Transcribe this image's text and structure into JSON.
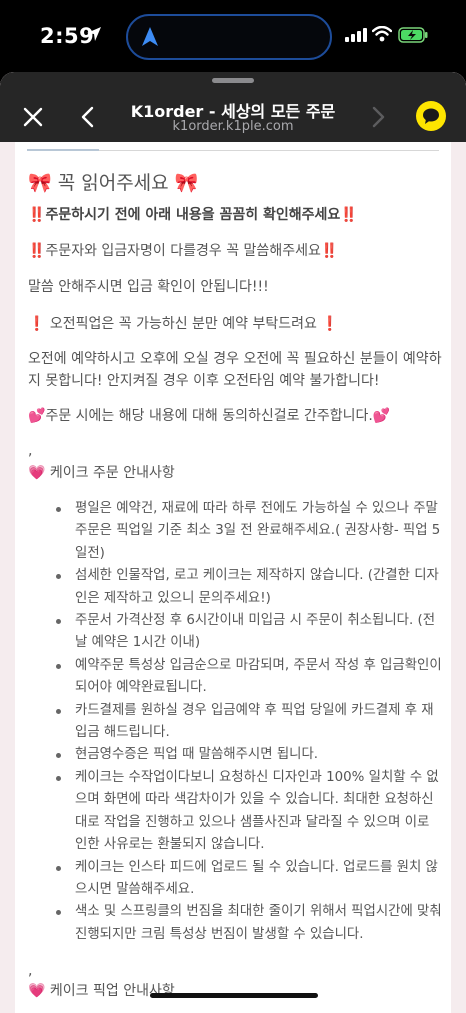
{
  "status_bar": {
    "time": "2:59"
  },
  "browser": {
    "title": "K1order - 세상의 모든 주문",
    "url": "k1order.k1ple.com"
  },
  "notice": {
    "heading_bow_left": "🎀",
    "heading": "꼭 읽어주세요",
    "heading_bow_right": "🎀",
    "line1_mark": "‼️",
    "line1": "주문하시기 전에 아래 내용을 꼼꼼히 확인해주세요",
    "line2_mark": "‼️",
    "line2": "주문자와 입금자명이 다를경우 꼭 말씀해주세요",
    "line3": "말씀 안해주시면 입금 확인이 안됩니다!!!",
    "line4_mark": "❗",
    "line4": "오전픽업은 꼭 가능하신 분만 예약 부탁드려요",
    "line5": "오전에 예약하시고 오후에 오실 경우 오전에 꼭 필요하신 분들이 예약하지 못합니다!  안지켜질 경우 이후 오전타임 예약 불가합니다!",
    "line6_mark": "💕",
    "line6": "주문 시에는 해당 내용에 대해 동의하신걸로 간주합니다.",
    "comma1": ",",
    "section1_heart": "💗",
    "section1": "케이크 주문 안내사항",
    "bullets": [
      "평일은 예약건, 재료에 따라 하루 전에도 가능하실 수 있으나 주말 주문은 픽업일 기준 최소 3일 전 완료해주세요.( 권장사항- 픽업  5일전)",
      "섬세한 인물작업, 로고 케이크는 제작하지 않습니다. (간결한 디자인은 제작하고 있으니 문의주세요!)",
      "주문서 가격산정 후 6시간이내 미입금 시 주문이 취소됩니다. (전날 예약은 1시간 이내)",
      "예약주문 특성상 입금순으로 마감되며, 주문서 작성 후 입금확인이 되어야 예약완료됩니다.",
      "카드결제를 원하실 경우 입금예약 후 픽업 당일에  카드결제 후 재입금 해드립니다.",
      "현금영수증은 픽업 때 말씀해주시면 됩니다.",
      "케이크는 수작업이다보니 요청하신 디자인과 100% 일치할 수 없으며 화면에 따라 색감차이가 있을 수 있습니다. 최대한 요청하신대로 작업을 진행하고 있으나 샘플사진과 달라질 수 있으며 이로 인한 사유로는 환불되지 않습니다.",
      "케이크는 인스타 피드에 업로드 될 수 있습니다. 업로드를 원치 않으시면 말씀해주세요.",
      "색소 및 스프링클의 번짐을  최대한 줄이기 위해서 픽업시간에 맞춰 진행되지만 크림 특성상 번짐이 발생할 수 있습니다."
    ],
    "comma2": ",",
    "section2_heart": "💗",
    "section2": "케이크 픽업 안내사항"
  }
}
